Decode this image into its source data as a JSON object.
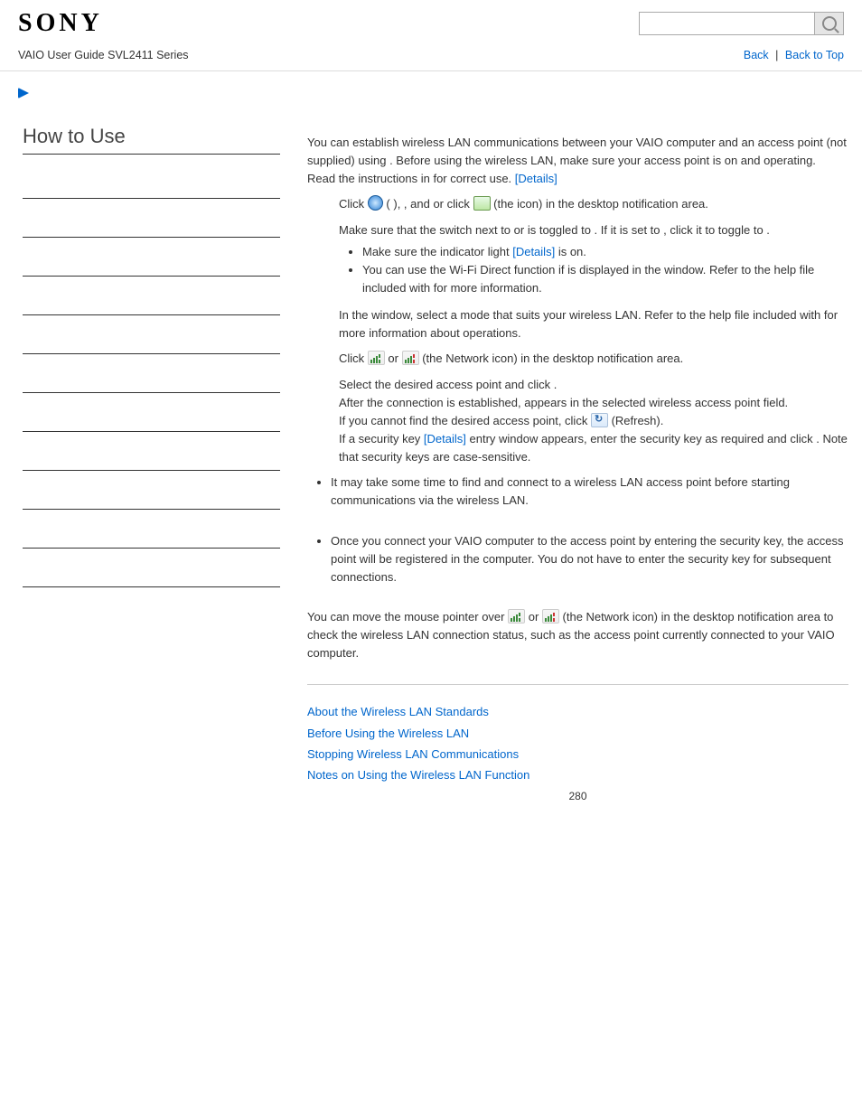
{
  "header": {
    "logo_text": "SONY",
    "subtitle": "VAIO User Guide SVL2411 Series",
    "back_link": "Back",
    "back_top_link": "Back to Top",
    "search_placeholder": ""
  },
  "left": {
    "heading": "How to Use"
  },
  "content": {
    "intro": {
      "p1_a": "You can establish wireless LAN communications between your VAIO computer and an access point (not supplied) using ",
      "p1_b": ". Before using the wireless LAN, make sure your access point is on and operating.",
      "p2_a": "Read the instructions in ",
      "p2_b": " for correct use. ",
      "details": "[Details]"
    },
    "steps": {
      "s1_a": "Click ",
      "s1_b": " ( ",
      "s1_c": "), ",
      "s1_d": ", and ",
      "s1_e": " or click ",
      "s1_f": " (the ",
      "s1_g": " icon) in the desktop notification area.",
      "s2_a": "Make sure that the switch next to ",
      "s2_b": " or ",
      "s2_c": " is toggled to ",
      "s2_d": ". If it is set to ",
      "s2_e": ", click it to toggle to ",
      "s2_f": ".",
      "s2_bullet1_a": "Make sure the ",
      "s2_bullet1_b": " indicator light ",
      "s2_bullet1_c": " is on.",
      "details": "[Details]",
      "s2_bullet2_a": "You can use the Wi-Fi Direct function if ",
      "s2_bullet2_b": " is displayed in the ",
      "s2_bullet2_c": " window. Refer to the help file included with ",
      "s2_bullet2_d": " for more information.",
      "s3_a": "In the ",
      "s3_b": " window, select a mode that suits your wireless LAN. Refer to the help file included with ",
      "s3_c": " for more information about operations.",
      "s4_a": "Click ",
      "s4_b": " or ",
      "s4_c": " (the Network icon) in the desktop notification area.",
      "s5_a": "Select the desired access point and click ",
      "s5_b": ".",
      "s5_c": "After the connection is established, ",
      "s5_d": " appears in the selected wireless access point field.",
      "s5_e": "If you cannot find the desired access point, click ",
      "s5_f": " (Refresh).",
      "s5_g": "If a security key ",
      "s5_h": " entry window appears, enter the security key as required and click ",
      "s5_i": ". Note that security keys are case-sensitive."
    },
    "notes": {
      "n1": "It may take some time to find and connect to a wireless LAN access point before starting communications via the wireless LAN.",
      "n2": "Once you connect your VAIO computer to the access point by entering the security key, the access point will be registered in the computer. You do not have to enter the security key for subsequent connections."
    },
    "status": {
      "t1": "You can move the mouse pointer over ",
      "t2": " or ",
      "t3": " (the Network icon) in the desktop notification area to check the wireless LAN connection status, such as the access point currently connected to your VAIO computer."
    },
    "related": {
      "l1": "About the Wireless LAN Standards",
      "l2": "Before Using the Wireless LAN",
      "l3": "Stopping Wireless LAN Communications",
      "l4": "Notes on Using the Wireless LAN Function"
    },
    "pagenum": "280"
  }
}
